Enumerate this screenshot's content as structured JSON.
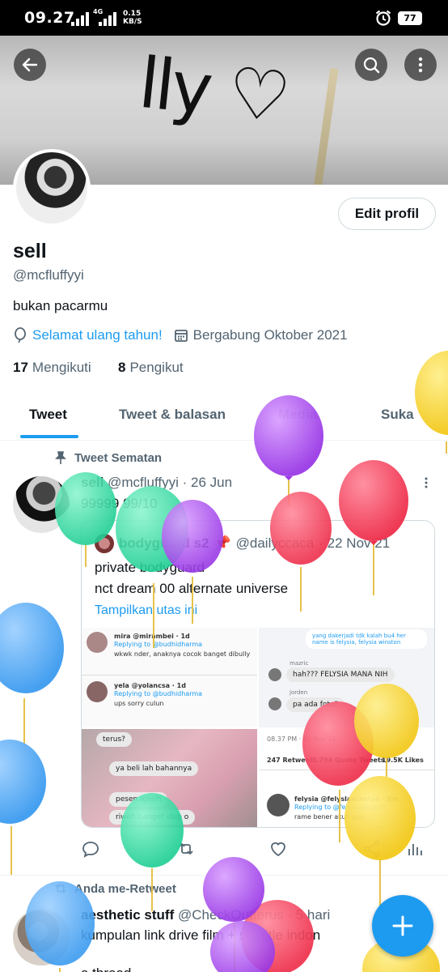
{
  "status_bar": {
    "time": "09.27",
    "network": "4G",
    "speed_value": "0.15",
    "speed_unit": "KB/S",
    "battery": "77",
    "alarm_icon": "alarm-clock-icon"
  },
  "header": {
    "banner_text": "lly ♡",
    "back_icon": "arrow-left-icon",
    "search_icon": "search-icon",
    "more_icon": "more-vertical-icon"
  },
  "profile": {
    "name": "sell",
    "handle": "@mcfluffyyi",
    "bio": "bukan pacarmu",
    "birthday_link": "Selamat ulang tahun!",
    "joined": "Bergabung Oktober 2021",
    "following_count": "17",
    "following_label": "Mengikuti",
    "followers_count": "8",
    "followers_label": "Pengikut",
    "edit_button": "Edit profil"
  },
  "tabs": [
    {
      "label": "Tweet",
      "active": true
    },
    {
      "label": "Tweet & balasan",
      "active": false
    },
    {
      "label": "Media",
      "active": false
    },
    {
      "label": "Suka",
      "active": false
    }
  ],
  "pinned_tweet": {
    "pinned_label": "Tweet Sematan",
    "author": "sell",
    "handle": "@mcfluffyyi",
    "date": "· 26 Jun",
    "text": "99999 99/10",
    "quote": {
      "author": "bodyguard s2",
      "emoji": "📌",
      "handle": "@dailyccaca",
      "date": "· 22 Nov 21",
      "line1": "private bodyguard",
      "line2": "nct dream 00 alternate universe",
      "thread_link": "Tampilkan utas ini",
      "screens": {
        "c1_user1": "mira @mirambei · 1d",
        "c1_reply1": "Replying to @budhidharma",
        "c1_text1": "wkwk nder, anaknya cocok banget dibully",
        "c1_user2": "yela @yolancsa · 1d",
        "c1_reply2": "Replying to @budhidharma",
        "c1_text2": "ups sorry culun",
        "c2_bubble1": "yang dakerjadi tdk kalah bu4 her name is felysia, felysia winston",
        "c2_name1": "mazric",
        "c2_bubble2": "hah??? FELYSIA MANA NIH",
        "c2_name2": "jorden",
        "c2_bubble3": "pa ada foto?",
        "c3_bubble1": "terus?",
        "c3_bubble2": "ya beli lah bahannya",
        "c3_bubble3": "pesen ajasih",
        "c3_bubble4": "riweh banget idup o",
        "c4_time": "08.37 PM · 05 Nov 21",
        "c4_retweets": "247 Retweet",
        "c4_quotes": "8,794 Quote Tweets",
        "c4_likes": "19.5K Likes",
        "c4_user": "felysia @felyslawinston · 8m",
        "c4_reply": "Replying to @felyslawinston",
        "c4_text": "rame bener akun gue..."
      }
    }
  },
  "retweet": {
    "label": "Anda me-Retweet",
    "author": "aesthetic stuff",
    "handle": "@CheckOutterus",
    "date": "· 5 hari",
    "text": "kumpulan link drive film + subtitle indon",
    "text2": "a thread"
  },
  "colors": {
    "accent": "#1d9bf0",
    "text": "#0f1419",
    "secondary": "#536471",
    "balloon_purple": "#a64df0",
    "balloon_red": "#f23e5a",
    "balloon_green": "#2ed9a0",
    "balloon_blue": "#4fa8f5",
    "balloon_yellow": "#f5d02a"
  }
}
